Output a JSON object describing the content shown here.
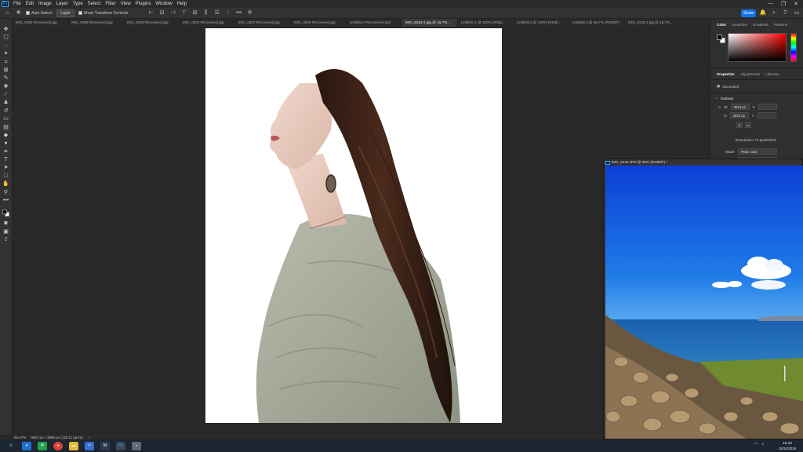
{
  "app": {
    "menu": [
      "File",
      "Edit",
      "Image",
      "Layer",
      "Type",
      "Select",
      "Filter",
      "View",
      "Plugins",
      "Window",
      "Help"
    ],
    "window_controls": [
      "—",
      "❐",
      "✕"
    ]
  },
  "options_bar": {
    "auto_select_label": "Auto-Select:",
    "auto_select_value": "Layer",
    "transform_controls_label": "Show Transform Controls",
    "more": "•••",
    "share_label": "Share"
  },
  "tabs": [
    {
      "label": "IMG_0483-Recovered.jpg",
      "active": false
    },
    {
      "label": "IMG_0485-Recovered.jpg",
      "active": false
    },
    {
      "label": "IMG_0526-Recovered.jpg",
      "active": false
    },
    {
      "label": "IMG_0534-Recovered.jpg",
      "active": false
    },
    {
      "label": "IMG_0537-Recovered.jpg",
      "active": false
    },
    {
      "label": "IMG_0542-Recovered.jpg",
      "active": false
    },
    {
      "label": "Untitled-2-Recovered.psd",
      "active": false
    },
    {
      "label": "IMG_8154-2.jpg @ 16.7%...",
      "active": true
    },
    {
      "label": "Untitled-1 @ 100% (RGB/...",
      "active": false
    },
    {
      "label": "Untitled-3 @ 100% (RGB/...",
      "active": false
    },
    {
      "label": "Untitled-4 @ 66.7% (RGB/8*)",
      "active": false
    },
    {
      "label": "IMG_8132-2.jpg @ 16.7%...",
      "active": false
    }
  ],
  "tools": [
    "move-tool",
    "artboard-tool",
    "lasso-tool",
    "object-select-tool",
    "crop-tool",
    "frame-tool",
    "eyedropper-tool",
    "healing-brush-tool",
    "brush-tool",
    "clone-stamp-tool",
    "history-brush-tool",
    "eraser-tool",
    "gradient-tool",
    "blur-tool",
    "dodge-tool",
    "pen-tool",
    "type-tool",
    "path-select-tool",
    "rectangle-tool",
    "hand-tool",
    "zoom-tool",
    "more-tools"
  ],
  "status": {
    "zoom": "66.67%",
    "doc_info": "3957 px x 3895 px (118.11 ppcm)"
  },
  "color_panel": {
    "tabs": [
      "Color",
      "Swatches",
      "Gradients",
      "Patterns"
    ],
    "active_tab": "Color"
  },
  "properties_panel": {
    "tabs": [
      "Properties",
      "Adjustments",
      "Libraries"
    ],
    "active_tab": "Properties",
    "document_label": "Document",
    "canvas_label": "Canvas",
    "w_label": "W",
    "w_value": "3024 px",
    "h_label": "H",
    "h_value": "4032 px",
    "x_label": "X",
    "y_label": "Y",
    "resolution": "Resolution: 72 pixels/inch",
    "mode_label": "Mode",
    "mode_value": "RGB Color",
    "bits_value": "8 Bits/Channel",
    "fill_label": "Fill",
    "fill_value": "Background Color"
  },
  "floating_window": {
    "title": "IMG_6144.JPG @ 25% (RGB/8*) *"
  },
  "taskbar": {
    "time": "15:18",
    "date": "15/11/2024"
  }
}
